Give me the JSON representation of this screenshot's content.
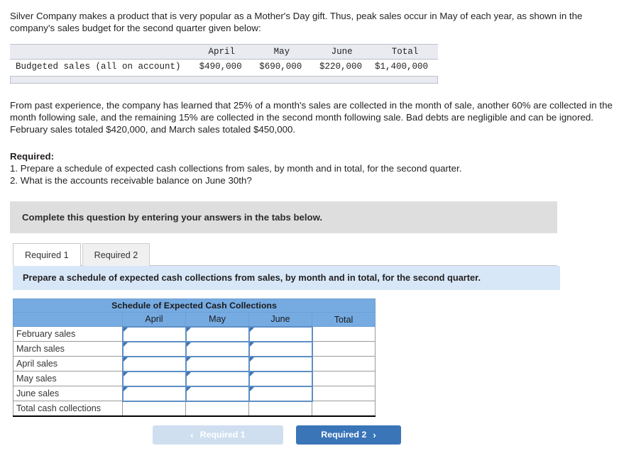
{
  "intro": {
    "paragraph_1": "Silver Company makes a product that is very popular as a Mother's Day gift. Thus, peak sales occur in May of each year, as shown in the company's sales budget for the second quarter given below:",
    "paragraph_2": "From past experience, the company has learned that 25% of a month's sales are collected in the month of sale, another 60% are collected in the month following sale, and the remaining 15% are collected in the second month following sale. Bad debts are negligible and can be ignored. February sales totaled $420,000, and March sales totaled $450,000."
  },
  "budget_table": {
    "columns": [
      "",
      "April",
      "May",
      "June",
      "Total"
    ],
    "rows": [
      {
        "label": "Budgeted sales (all on account)",
        "april": "$490,000",
        "may": "$690,000",
        "june": "$220,000",
        "total": "$1,400,000"
      }
    ]
  },
  "required": {
    "title": "Required:",
    "item_1": "1. Prepare a schedule of expected cash collections from sales, by month and in total, for the second quarter.",
    "item_2": "2. What is the accounts receivable balance on June 30th?"
  },
  "complete_bar": {
    "text": "Complete this question by entering your answers in the tabs below."
  },
  "tabs": [
    {
      "label": "Required 1",
      "active": true
    },
    {
      "label": "Required 2",
      "active": false
    }
  ],
  "instruction": {
    "text": "Prepare a schedule of expected cash collections from sales, by month and in total, for the second quarter."
  },
  "answer_table": {
    "title": "Schedule of Expected Cash Collections",
    "columns": [
      "",
      "April",
      "May",
      "June",
      "Total"
    ],
    "rows": [
      {
        "label": "February sales",
        "april": "",
        "may": "",
        "june": "",
        "total": ""
      },
      {
        "label": "March sales",
        "april": "",
        "may": "",
        "june": "",
        "total": ""
      },
      {
        "label": "April sales",
        "april": "",
        "may": "",
        "june": "",
        "total": ""
      },
      {
        "label": "May sales",
        "april": "",
        "may": "",
        "june": "",
        "total": ""
      },
      {
        "label": "June sales",
        "april": "",
        "may": "",
        "june": "",
        "total": ""
      },
      {
        "label": "Total cash collections",
        "april": "",
        "may": "",
        "june": "",
        "total": ""
      }
    ]
  },
  "nav": {
    "prev_label": "Required 1",
    "prev_icon": "chevron-left-icon",
    "prev_disabled": true,
    "next_label": "Required 2",
    "next_icon": "chevron-right-icon"
  },
  "colors": {
    "header_blue": "#76abe2",
    "instruction_blue": "#d7e7f7",
    "complete_gray": "#dedede",
    "button_blue": "#3a75b8",
    "button_disabled": "#cfdff0",
    "input_border": "#5e8fc4",
    "marker_blue": "#3c73b5"
  }
}
